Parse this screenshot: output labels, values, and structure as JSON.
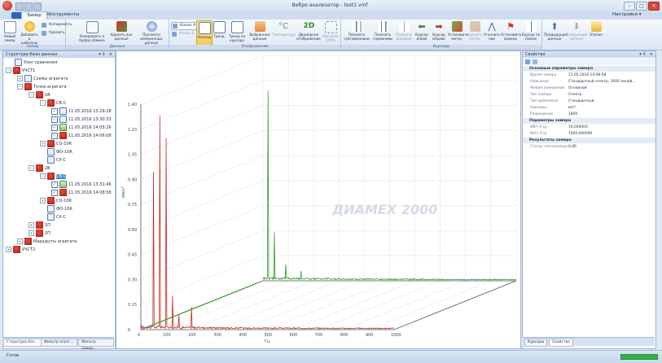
{
  "window": {
    "title": "Вибро анализатор - test1.vmf",
    "minimize": "–",
    "maximize": "□",
    "close": "✕"
  },
  "tabs": [
    "Замер",
    "Инструменты"
  ],
  "settings_menu": "Настройки ▾",
  "ribbon": {
    "group_zamer": {
      "label": "Замер",
      "new": "Новый замер",
      "add_template": "Добавить в шаблоны",
      "copy": "Копировать",
      "delete": "Удалить"
    },
    "group_data": {
      "label": "Данные",
      "copy_buffer": "Копировать в буфер обмена",
      "delete_all": "Удалить все данные",
      "view": "Просмотр измеренных данных"
    },
    "group_display": {
      "label": "Отображение",
      "channel_a": "Канал А",
      "channel_b": "Канал Б",
      "cascade": "Каскад",
      "trend": "Тренд",
      "trend_cursor": "Тренд по курсору",
      "selected": "Выбранные данные",
      "temperature": "Температура",
      "two_d": "Двумерное отображение",
      "scale": "Масштаб 100%"
    },
    "group_cursors": {
      "label": "Курсоры",
      "show_sub": "Показать субгармоники",
      "show_harm": "Показать гармоники",
      "show_side": "Показать боковые",
      "cursor_left": "Курсор влево",
      "cursor_right": "Курсор вправо",
      "set_mark": "Установить метку",
      "del_mark": "Удалить метку",
      "clarify_peak": "Уточнить пик",
      "set_marker": "Установить маркер",
      "cursor_peak": "Курсор по пикам"
    },
    "group_nav": {
      "prev": "Предыдущие данные",
      "next": "Следующие данные",
      "etalon": "Эталон"
    }
  },
  "left_panel": {
    "title": "Структура базы данных",
    "tree": [
      {
        "label": "Узел сравнения"
      },
      {
        "label": "УЧСТ1"
      },
      {
        "label": "Схемы агрегата"
      },
      {
        "label": "Точки агрегата"
      },
      {
        "label": "1В"
      },
      {
        "label": "СВ-С"
      },
      {
        "label": "11.05.2016 13:29:28"
      },
      {
        "label": "11.05.2016 13:30:33"
      },
      {
        "label": "11.05.2016 14:05:26"
      },
      {
        "label": "11.05.2016 14:06:08"
      },
      {
        "label": "СО-10К"
      },
      {
        "label": "ФО-10К"
      },
      {
        "label": "СУ-С"
      },
      {
        "label": "2В"
      },
      {
        "label": "СВ-С"
      },
      {
        "label": "11.05.2016 13:31:46"
      },
      {
        "label": "11.05.2016 14:08:58"
      },
      {
        "label": "СО-10К"
      },
      {
        "label": "ФО-10К"
      },
      {
        "label": "СУ-С"
      },
      {
        "label": "1П"
      },
      {
        "label": "2П"
      },
      {
        "label": "Маршруты агрегата"
      },
      {
        "label": "УЧСТ2"
      }
    ],
    "tabs": [
      "Структура баз...",
      "Фильтр агрег...",
      "Фильтр замер..."
    ]
  },
  "chart_data": {
    "type": "line",
    "subtype": "cascade-3d",
    "xlabel": "Гц",
    "ylabel": "мм/с²",
    "x_ticks": [
      0,
      100,
      200,
      300,
      400,
      500,
      600,
      700,
      800,
      900,
      1000
    ],
    "y_ticks": [
      "0",
      "0.15",
      "0.30",
      "0.45",
      "0.60",
      "0.75",
      "0.90",
      "1.05",
      "1.23",
      "1.40"
    ],
    "ylim": [
      0,
      1.4
    ],
    "xlim": [
      0,
      1000
    ],
    "watermark": "ДИАМЕХ 2000",
    "series": [
      {
        "color": "#c8281b",
        "peaks": [
          {
            "x": 50,
            "y": 0.98
          },
          {
            "x": 75,
            "y": 1.33
          },
          {
            "x": 100,
            "y": 1.19
          },
          {
            "x": 125,
            "y": 0.21
          },
          {
            "x": 150,
            "y": 0.09
          },
          {
            "x": 200,
            "y": 0.14
          }
        ]
      },
      {
        "color": "#2f9b2d",
        "peaks": [
          {
            "x": 20,
            "y": 1.18
          },
          {
            "x": 45,
            "y": 0.3
          },
          {
            "x": 90,
            "y": 0.1
          },
          {
            "x": 150,
            "y": 0.06
          }
        ]
      }
    ]
  },
  "right_panel": {
    "title": "Свойства",
    "sections": [
      {
        "title": "Основные параметры замера",
        "rows": [
          {
            "name": "Время замера",
            "value": "11.05.2016 14:08:58"
          },
          {
            "name": "Описание",
            "value": "Стандартный спектр, 1600 линий..."
          },
          {
            "name": "Режим измерений",
            "value": "Основной"
          },
          {
            "name": "Тип замера",
            "value": "Спектр"
          },
          {
            "name": "Тип диапазона",
            "value": "Стандартный"
          },
          {
            "name": "Единицы",
            "value": "м/с²"
          },
          {
            "name": "Разрешение",
            "value": "1600"
          }
        ]
      },
      {
        "title": "Параметры замера",
        "rows": [
          {
            "name": "ФВЧ (Гц)",
            "value": "10,000000"
          },
          {
            "name": "ФНЧ (Гц)",
            "value": "1000,000000"
          }
        ]
      },
      {
        "title": "Результаты замера",
        "rows": [
          {
            "name": "Статус сигнализации",
            "value": "0,06"
          }
        ]
      }
    ],
    "tabs": [
      "Курсоры",
      "Свойства"
    ]
  },
  "status": {
    "text": "Готов",
    "progress": 1.0
  }
}
